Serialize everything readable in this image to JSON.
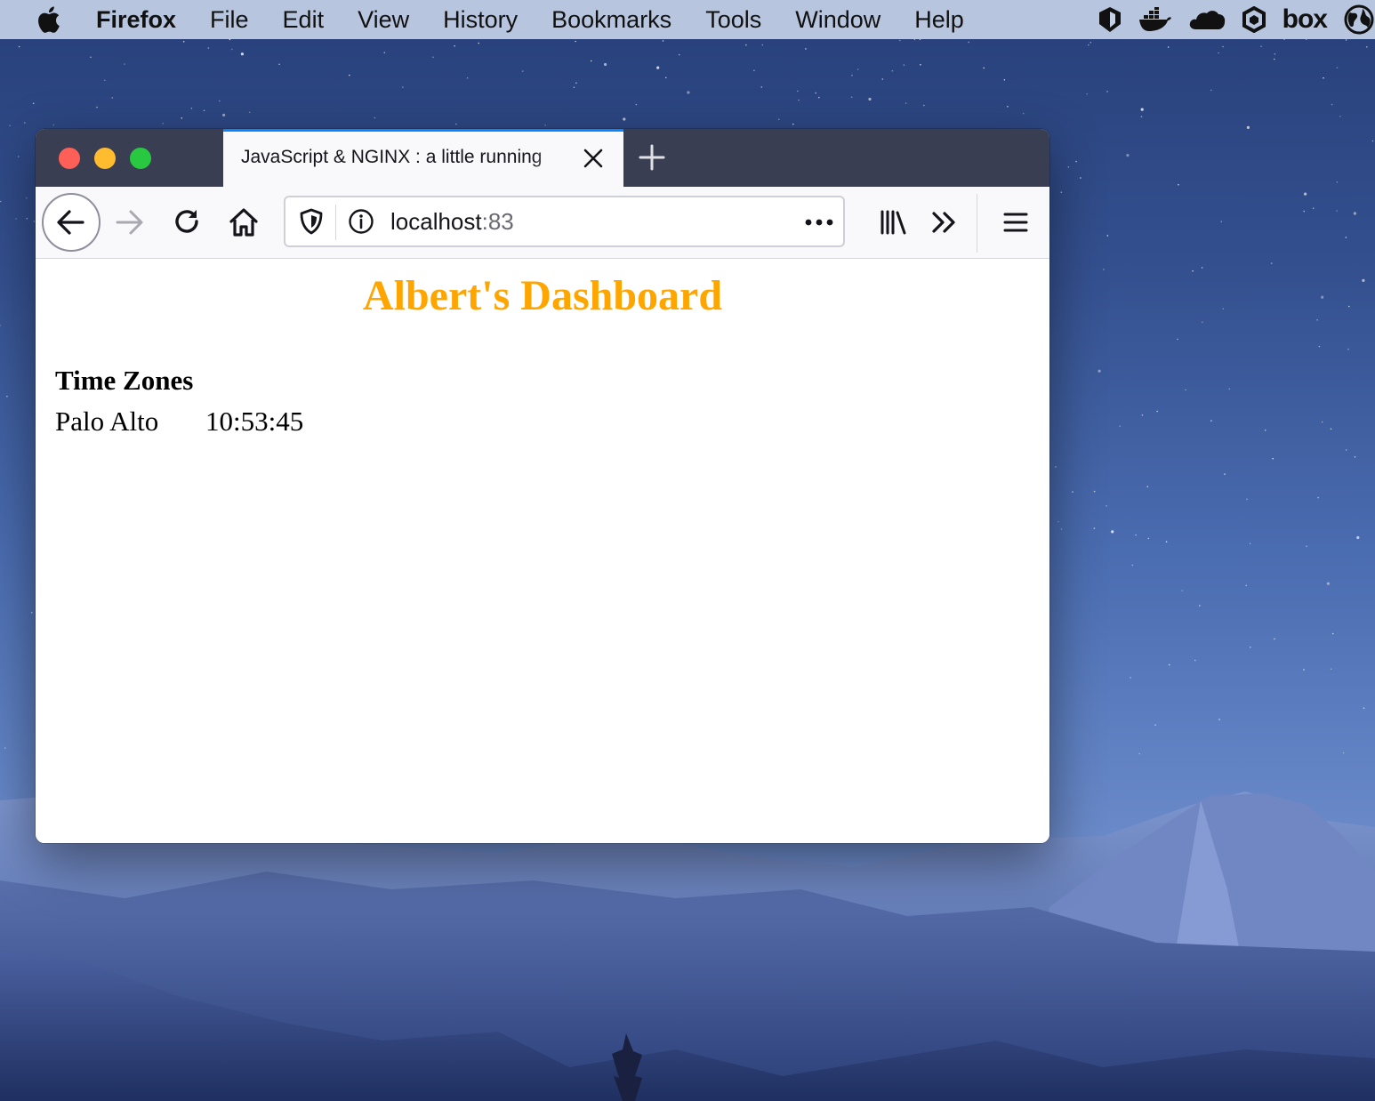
{
  "menubar": {
    "app_name": "Firefox",
    "items": [
      "File",
      "Edit",
      "View",
      "History",
      "Bookmarks",
      "Tools",
      "Window",
      "Help"
    ],
    "status_icons": [
      "bitwarden-icon",
      "docker-icon",
      "onedrive-icon",
      "hexagon-app-icon",
      "box-icon",
      "globe-icon"
    ],
    "box_label": "box"
  },
  "browser": {
    "tab": {
      "title": "JavaScript & NGINX : a little running"
    },
    "url": {
      "host": "localhost",
      "port": ":83"
    },
    "colors": {
      "tab_accent": "#0a84ff",
      "tabbar_bg": "#393e52",
      "toolbar_bg": "#f9f9fb"
    }
  },
  "page": {
    "title": "Albert's Dashboard",
    "title_color": "#ffa500",
    "section_heading": "Time Zones",
    "timezones": [
      {
        "city": "Palo Alto",
        "time": "10:53:45"
      }
    ]
  }
}
